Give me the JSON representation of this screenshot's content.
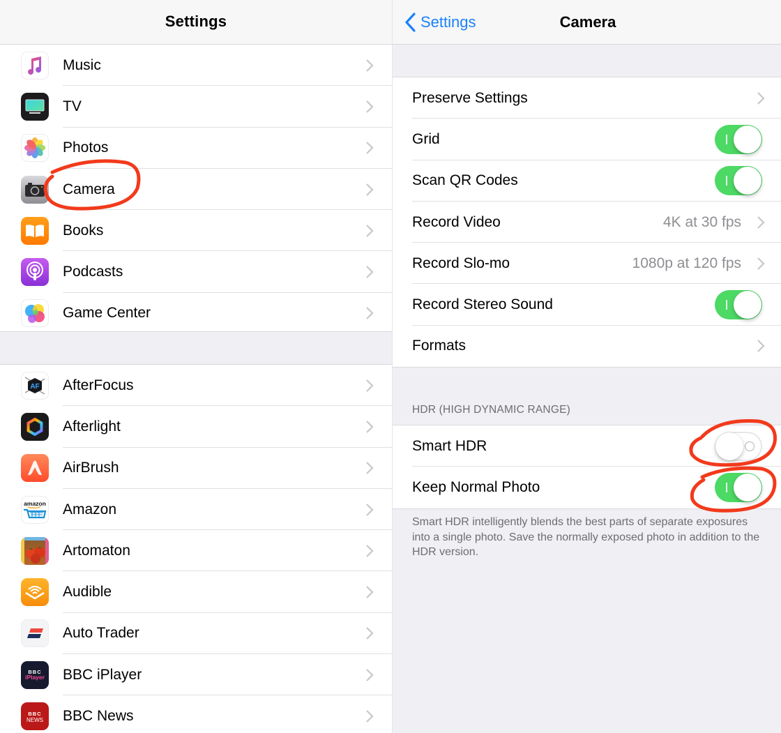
{
  "left_pane": {
    "title": "Settings",
    "group1": [
      {
        "label": "Music",
        "icon": "music-icon"
      },
      {
        "label": "TV",
        "icon": "tv-icon"
      },
      {
        "label": "Photos",
        "icon": "photos-icon"
      },
      {
        "label": "Camera",
        "icon": "camera-icon"
      },
      {
        "label": "Books",
        "icon": "books-icon"
      },
      {
        "label": "Podcasts",
        "icon": "podcasts-icon"
      },
      {
        "label": "Game Center",
        "icon": "game-center-icon"
      }
    ],
    "group2": [
      {
        "label": "AfterFocus",
        "icon": "afterfocus-icon"
      },
      {
        "label": "Afterlight",
        "icon": "afterlight-icon"
      },
      {
        "label": "AirBrush",
        "icon": "airbrush-icon"
      },
      {
        "label": "Amazon",
        "icon": "amazon-icon"
      },
      {
        "label": "Artomaton",
        "icon": "artomaton-icon"
      },
      {
        "label": "Audible",
        "icon": "audible-icon"
      },
      {
        "label": "Auto Trader",
        "icon": "auto-trader-icon"
      },
      {
        "label": "BBC iPlayer",
        "icon": "bbc-iplayer-icon"
      },
      {
        "label": "BBC News",
        "icon": "bbc-news-icon"
      }
    ],
    "icon_text": {
      "afterfocus": "AF",
      "amazon": "amazon",
      "bbc": "BBC",
      "iplayer": "iPlayer",
      "news": "NEWS"
    }
  },
  "right_pane": {
    "back_label": "Settings",
    "title": "Camera",
    "group1": [
      {
        "label": "Preserve Settings",
        "type": "link",
        "value": ""
      },
      {
        "label": "Grid",
        "type": "toggle",
        "on": true
      },
      {
        "label": "Scan QR Codes",
        "type": "toggle",
        "on": true
      },
      {
        "label": "Record Video",
        "type": "link",
        "value": "4K at 30 fps"
      },
      {
        "label": "Record Slo-mo",
        "type": "link",
        "value": "1080p at 120 fps"
      },
      {
        "label": "Record Stereo Sound",
        "type": "toggle",
        "on": true
      },
      {
        "label": "Formats",
        "type": "link",
        "value": ""
      }
    ],
    "hdr_section_header": "HDR (HIGH DYNAMIC RANGE)",
    "hdr_group": [
      {
        "label": "Smart HDR",
        "type": "toggle",
        "on": false
      },
      {
        "label": "Keep Normal Photo",
        "type": "toggle",
        "on": true
      }
    ],
    "footer_note": "Smart HDR intelligently blends the best parts of separate exposures into a single photo. Save the normally exposed photo in addition to the HDR version."
  },
  "colors": {
    "accent_blue": "#1a82fb",
    "toggle_green": "#4cd964",
    "annotation_red": "#f23a1c",
    "secondary_text": "#8e8e93",
    "background_gray": "#efeff4"
  }
}
